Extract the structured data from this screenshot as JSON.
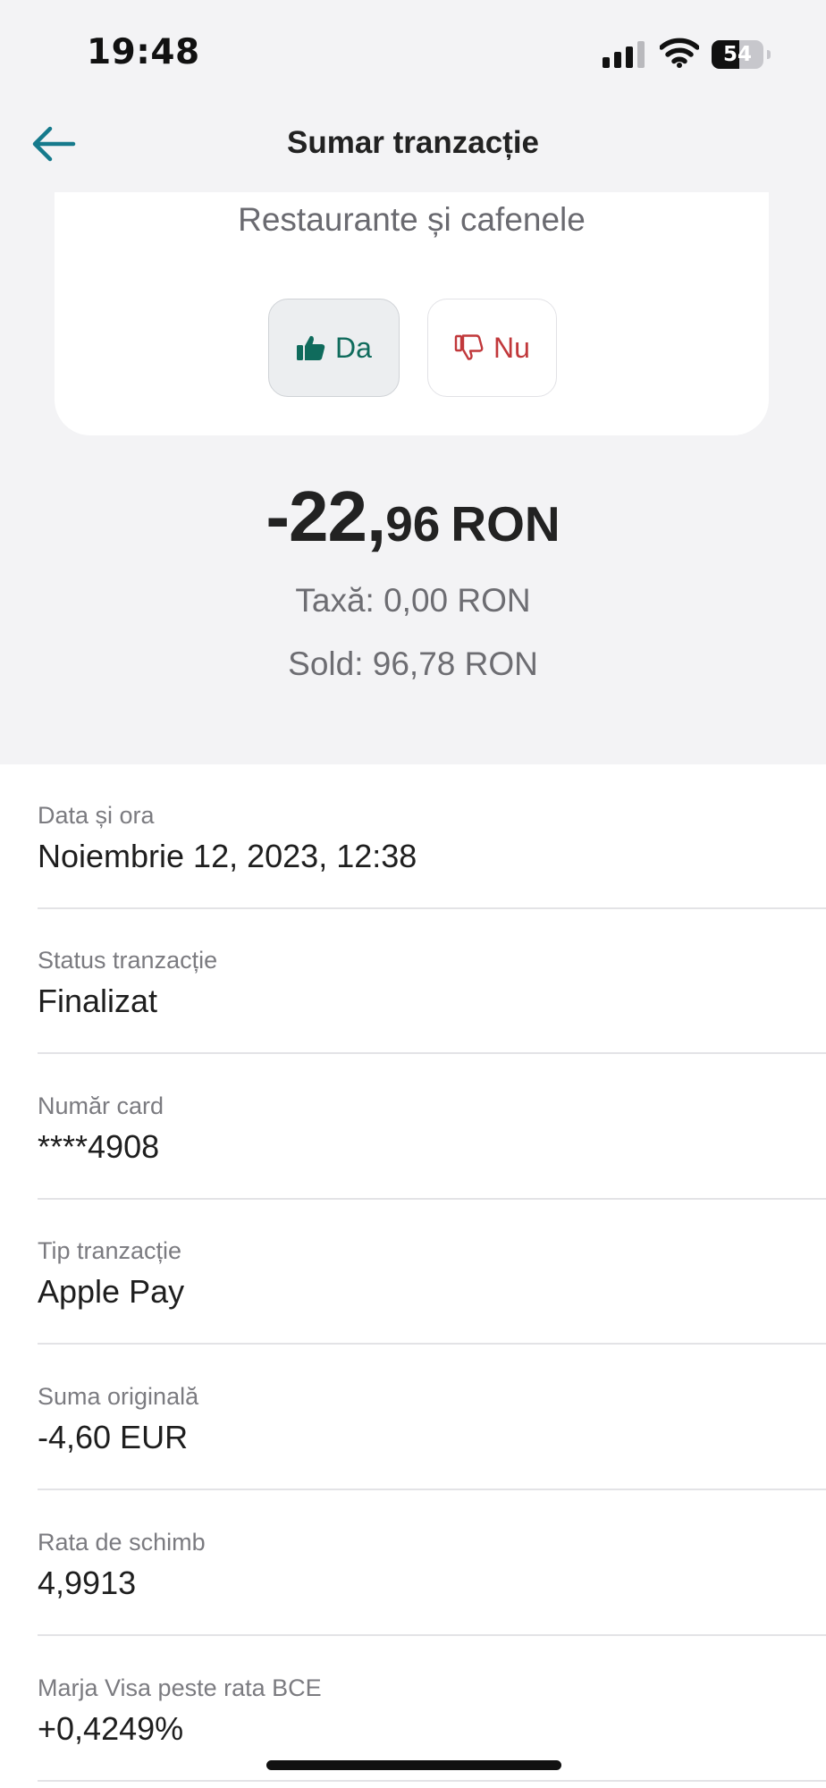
{
  "status_bar": {
    "time": "19:48",
    "battery": "54"
  },
  "header": {
    "title": "Sumar tranzacție"
  },
  "category": {
    "name": "Restaurante și cafenele",
    "yes_label": "Da",
    "no_label": "Nu"
  },
  "amount": {
    "integer_part": "-22,",
    "decimal_part": "96",
    "currency": "RON",
    "fee": "Taxă: 0,00 RON",
    "balance": "Sold: 96,78 RON"
  },
  "details": [
    {
      "label": "Data și ora",
      "value": "Noiembrie 12, 2023, 12:38"
    },
    {
      "label": "Status tranzacție",
      "value": "Finalizat"
    },
    {
      "label": "Număr card",
      "value": "****4908"
    },
    {
      "label": "Tip tranzacție",
      "value": "Apple Pay"
    },
    {
      "label": "Suma originală",
      "value": "-4,60 EUR"
    },
    {
      "label": "Rata de schimb",
      "value": "4,9913"
    },
    {
      "label": "Marja Visa peste rata BCE",
      "value": "+0,4249%"
    }
  ],
  "colors": {
    "accent": "#0f6b5c",
    "negative": "#c1383b",
    "background": "#f3f3f5"
  },
  "icons": [
    "back-arrow-icon",
    "thumbs-up-icon",
    "thumbs-down-icon",
    "signal-icon",
    "wifi-icon",
    "battery-icon"
  ]
}
